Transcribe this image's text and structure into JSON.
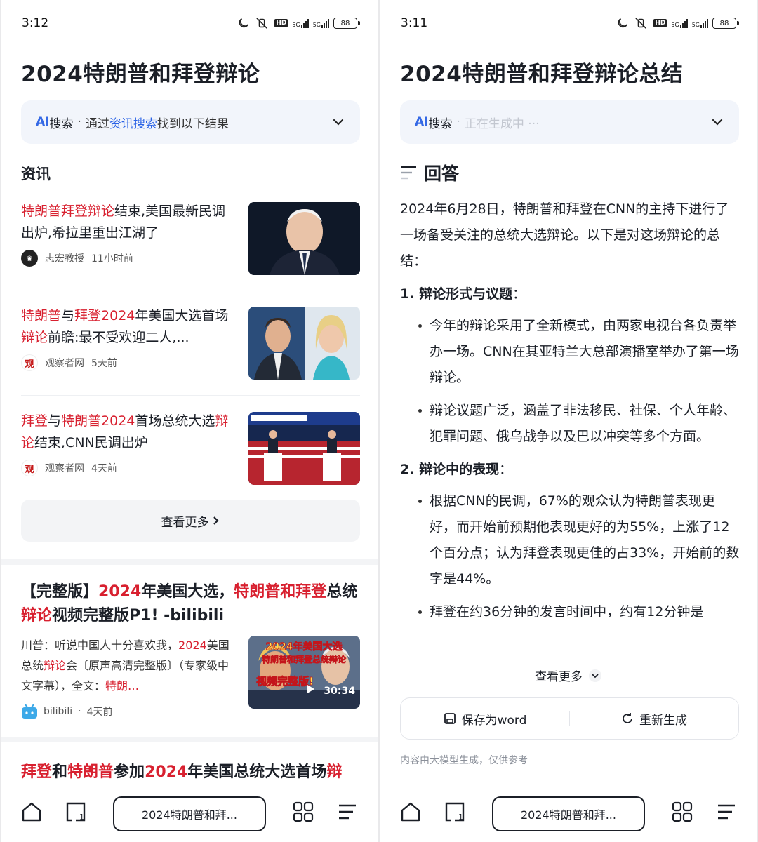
{
  "colors": {
    "highlight": "#d8202f",
    "ai_blue": "#3569e5",
    "link_blue": "#2b63e6",
    "text": "#1b1f27"
  },
  "left": {
    "status": {
      "time": "3:12",
      "battery": "88",
      "hd": "HD",
      "net1": "5G",
      "net2": "5G"
    },
    "page_title": "2024特朗普和拜登辩论",
    "ai_bar": {
      "ai": "AI",
      "label": "搜索",
      "dot": "·",
      "prefix": "通过",
      "link": "资讯搜索",
      "suffix": "找到以下结果"
    },
    "section_label": "资讯",
    "news": [
      {
        "title_parts": [
          {
            "t": "特朗普拜登辩论",
            "h": true
          },
          {
            "t": "结束,美国最新民调出炉,希拉里重出江湖了",
            "h": false
          }
        ],
        "source": "志宏教授",
        "time": "11小时前",
        "thumb": "biden-portrait"
      },
      {
        "title_parts": [
          {
            "t": "特朗普",
            "h": true
          },
          {
            "t": "与",
            "h": false
          },
          {
            "t": "拜登2024",
            "h": true
          },
          {
            "t": "年美国大选首场",
            "h": false
          },
          {
            "t": "辩论",
            "h": true
          },
          {
            "t": "前瞻:最不受欢迎二人,...",
            "h": false
          }
        ],
        "source": "观察者网",
        "time": "5天前",
        "thumb": "cnn-moderators"
      },
      {
        "title_parts": [
          {
            "t": "拜登",
            "h": true
          },
          {
            "t": "与",
            "h": false
          },
          {
            "t": "特朗普2024",
            "h": true
          },
          {
            "t": "首场总统大选",
            "h": false
          },
          {
            "t": "辩论",
            "h": true
          },
          {
            "t": "结束,CNN民调出炉",
            "h": false
          }
        ],
        "source": "观察者网",
        "time": "4天前",
        "thumb": "debate-stage"
      }
    ],
    "more_button": "查看更多",
    "video": {
      "title_parts": [
        {
          "t": "【完整版】",
          "h": false
        },
        {
          "t": "2024",
          "h": true
        },
        {
          "t": "年美国大选，",
          "h": false
        },
        {
          "t": "特朗普和拜登",
          "h": true
        },
        {
          "t": "总统",
          "h": false
        },
        {
          "t": "辩论",
          "h": true
        },
        {
          "t": "视频完整版P1! -bilibili",
          "h": false
        }
      ],
      "snippet_parts": [
        {
          "t": "川普：听说中国人十分喜欢我，",
          "h": false
        },
        {
          "t": "2024",
          "h": true
        },
        {
          "t": "美国总统",
          "h": false
        },
        {
          "t": "辩论",
          "h": true
        },
        {
          "t": "会〔原声高清完整版〕（专家级中文字幕），全文：",
          "h": false
        },
        {
          "t": "特朗…",
          "h": true
        }
      ],
      "source": "bilibili",
      "time": "4天前",
      "duration": "30:34",
      "thumb_caption1": "2024年美国大选",
      "thumb_caption2": "特朗普和拜登总统辩论",
      "thumb_caption3": "视频完整版!"
    },
    "cut_title_parts": [
      {
        "t": "拜登",
        "h": true
      },
      {
        "t": "和",
        "h": false
      },
      {
        "t": "特朗普",
        "h": true
      },
      {
        "t": "参加",
        "h": false
      },
      {
        "t": "2024",
        "h": true
      },
      {
        "t": "年美国总统大选首场",
        "h": false
      },
      {
        "t": "辩",
        "h": true
      }
    ],
    "address": "2024特朗普和拜..."
  },
  "right": {
    "status": {
      "time": "3:11",
      "battery": "88",
      "hd": "HD",
      "net1": "5G",
      "net2": "5G"
    },
    "page_title": "2024特朗普和拜登辩论总结",
    "ai_bar": {
      "ai": "AI",
      "label": "搜索",
      "dot": "·",
      "status": "正在生成中 ···"
    },
    "answer_heading": "回答",
    "intro": "2024年6月28日，特朗普和拜登在CNN的主持下进行了一场备受关注的总统大选辩论。以下是对这场辩论的总结：",
    "sections": [
      {
        "num": "1.",
        "heading": "辩论形式与议题",
        "colon": "：",
        "bullets": [
          "今年的辩论采用了全新模式，由两家电视台各负责举办一场。CNN在其亚特兰大总部演播室举办了第一场辩论。",
          "辩论议题广泛，涵盖了非法移民、社保、个人年龄、犯罪问题、俄乌战争以及巴以冲突等多个方面。"
        ]
      },
      {
        "num": "2.",
        "heading": "辩论中的表现",
        "colon": "：",
        "bullets": [
          "根据CNN的民调，67%的观众认为特朗普表现更好，而开始前预期他表现更好的为55%，上涨了12个百分点；认为拜登表现更佳的占33%，开始前的数字是44%。",
          "拜登在约36分钟的发言时间中，约有12分钟是"
        ]
      }
    ],
    "see_more": "查看更多",
    "save_word": "保存为word",
    "regenerate": "重新生成",
    "disclaimer": "内容由大模型生成，仅供参考",
    "address": "2024特朗普和拜..."
  }
}
